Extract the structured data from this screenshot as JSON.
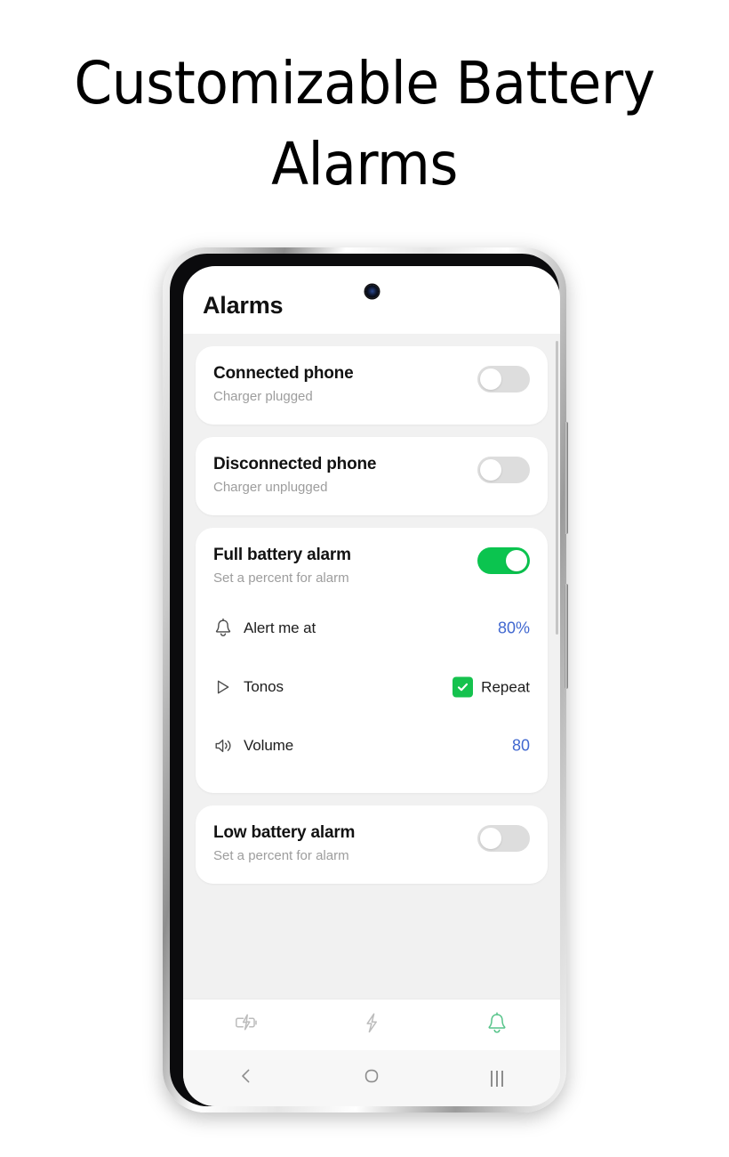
{
  "headline": "Customizable Battery Alarms",
  "phone": {
    "screen_title": "Alarms",
    "cards": [
      {
        "id": "connected-phone",
        "title": "Connected phone",
        "subtitle": "Charger plugged",
        "toggle_state": "off"
      },
      {
        "id": "disconnected-phone",
        "title": "Disconnected phone",
        "subtitle": "Charger unplugged",
        "toggle_state": "off"
      },
      {
        "id": "full-battery-alarm",
        "title": "Full battery alarm",
        "subtitle": "Set a percent for alarm",
        "toggle_state": "on",
        "options": [
          {
            "icon": "bell-icon",
            "label": "Alert me at",
            "value": "80%"
          },
          {
            "icon": "play-icon",
            "label": "Tonos",
            "checkbox_label": "Repeat",
            "checkbox_state": "checked"
          },
          {
            "icon": "volume-icon",
            "label": "Volume",
            "value": "80"
          }
        ]
      },
      {
        "id": "low-battery-alarm",
        "title": "Low battery alarm",
        "subtitle": "Set a percent for alarm",
        "toggle_state": "off"
      }
    ],
    "tabs": [
      {
        "icon": "battery-charging-icon",
        "active": false
      },
      {
        "icon": "lightning-bolt-icon",
        "active": false
      },
      {
        "icon": "bell-icon",
        "active": true
      }
    ],
    "navbar": [
      {
        "icon": "back-icon"
      },
      {
        "icon": "home-icon"
      },
      {
        "icon": "recents-icon"
      }
    ]
  },
  "colors": {
    "toggle_on": "#0bc44f",
    "checkbox_green": "#15c24e",
    "value_blue": "#4168d0",
    "tab_active_green": "#57c48a",
    "tab_inactive_gray": "#b9b9b9",
    "page_bg": "#f1f1f1",
    "card_bg": "#ffffff",
    "subtitle_gray": "#9d9d9d"
  }
}
